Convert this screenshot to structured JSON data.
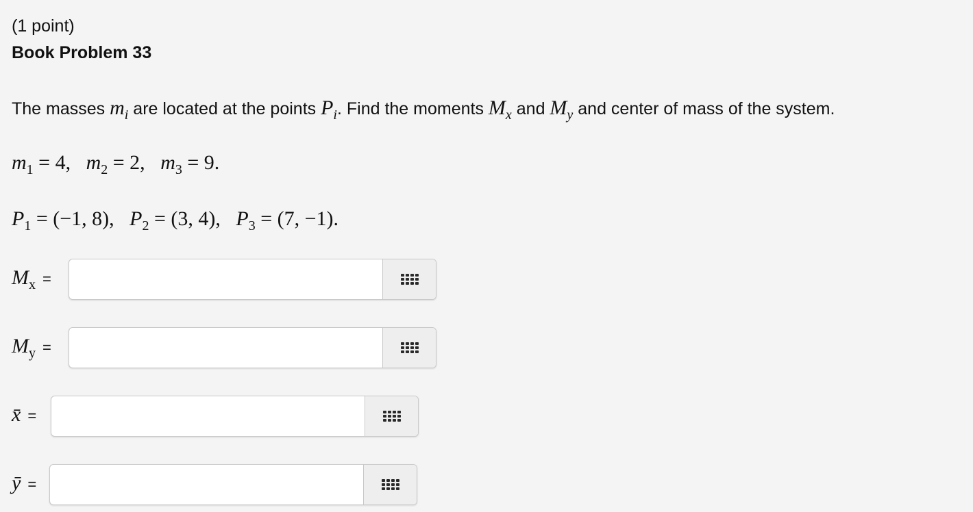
{
  "header": {
    "points": "(1 point)",
    "title": "Book Problem 33"
  },
  "problem": {
    "text_1": "The masses ",
    "m_i_base": "m",
    "m_i_sub": "i",
    "text_2": " are located at the points ",
    "P_i_base": "P",
    "P_i_sub": "i",
    "text_3": ". Find the moments ",
    "Mx_base": "M",
    "Mx_sub": "x",
    "text_4": " and ",
    "My_base": "M",
    "My_sub": "y",
    "text_5": " and center of mass of the system."
  },
  "masses": {
    "m1_label": "m",
    "m1_sub": "1",
    "m1_value": " = 4,",
    "m2_label": "m",
    "m2_sub": "2",
    "m2_value": " = 2,",
    "m3_label": "m",
    "m3_sub": "3",
    "m3_value": " = 9."
  },
  "points_line": {
    "p1_label": "P",
    "p1_sub": "1",
    "p1_value": " = (−1, 8),",
    "p2_label": "P",
    "p2_sub": "2",
    "p2_value": " = (3, 4),",
    "p3_label": "P",
    "p3_sub": "3",
    "p3_value": " = (7, −1)."
  },
  "answers": [
    {
      "label": "M",
      "sub": "x",
      "eq": "=",
      "value": ""
    },
    {
      "label": "M",
      "sub": "y",
      "eq": "=",
      "value": ""
    },
    {
      "label": "x̄",
      "sub": "",
      "eq": "=",
      "value": ""
    },
    {
      "label": "ȳ",
      "sub": "",
      "eq": "=",
      "value": ""
    }
  ],
  "icons": {
    "equation_editor": "grid-icon"
  }
}
